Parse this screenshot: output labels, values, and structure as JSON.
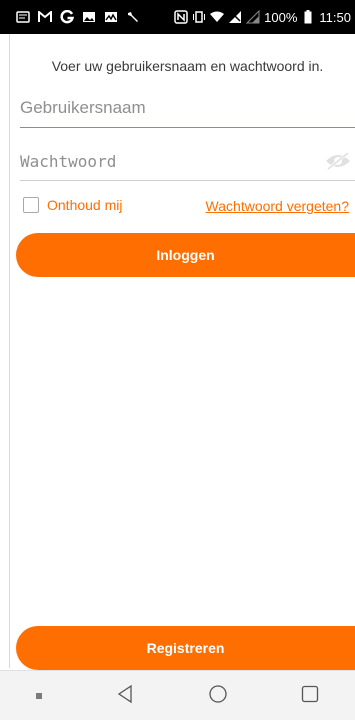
{
  "status_bar": {
    "battery": "100%",
    "time": "11:50",
    "left_icons": [
      "messages-icon",
      "gmail-icon",
      "google-icon",
      "gallery-icon",
      "image-icon",
      "wrench-icon"
    ],
    "right_icons": [
      "nfc-icon",
      "vibrate-icon",
      "wifi-icon",
      "no-signal-icon",
      "signal-icon",
      "battery-icon"
    ]
  },
  "login": {
    "intro": "Voer uw gebruikersnaam en wachtwoord in.",
    "username_placeholder": "Gebruikersnaam",
    "password_placeholder": "Wachtwoord",
    "remember_label": "Onthoud mij",
    "forgot_label": "Wachtwoord vergeten?",
    "login_button": "Inloggen",
    "register_button": "Registreren"
  },
  "navigation": {
    "buttons": [
      "recent-dot-icon",
      "back-icon",
      "home-icon",
      "overview-icon"
    ]
  },
  "colors": {
    "accent": "#ff6e00",
    "status_bar": "#000000",
    "nav_bar": "#f3f3f3"
  }
}
